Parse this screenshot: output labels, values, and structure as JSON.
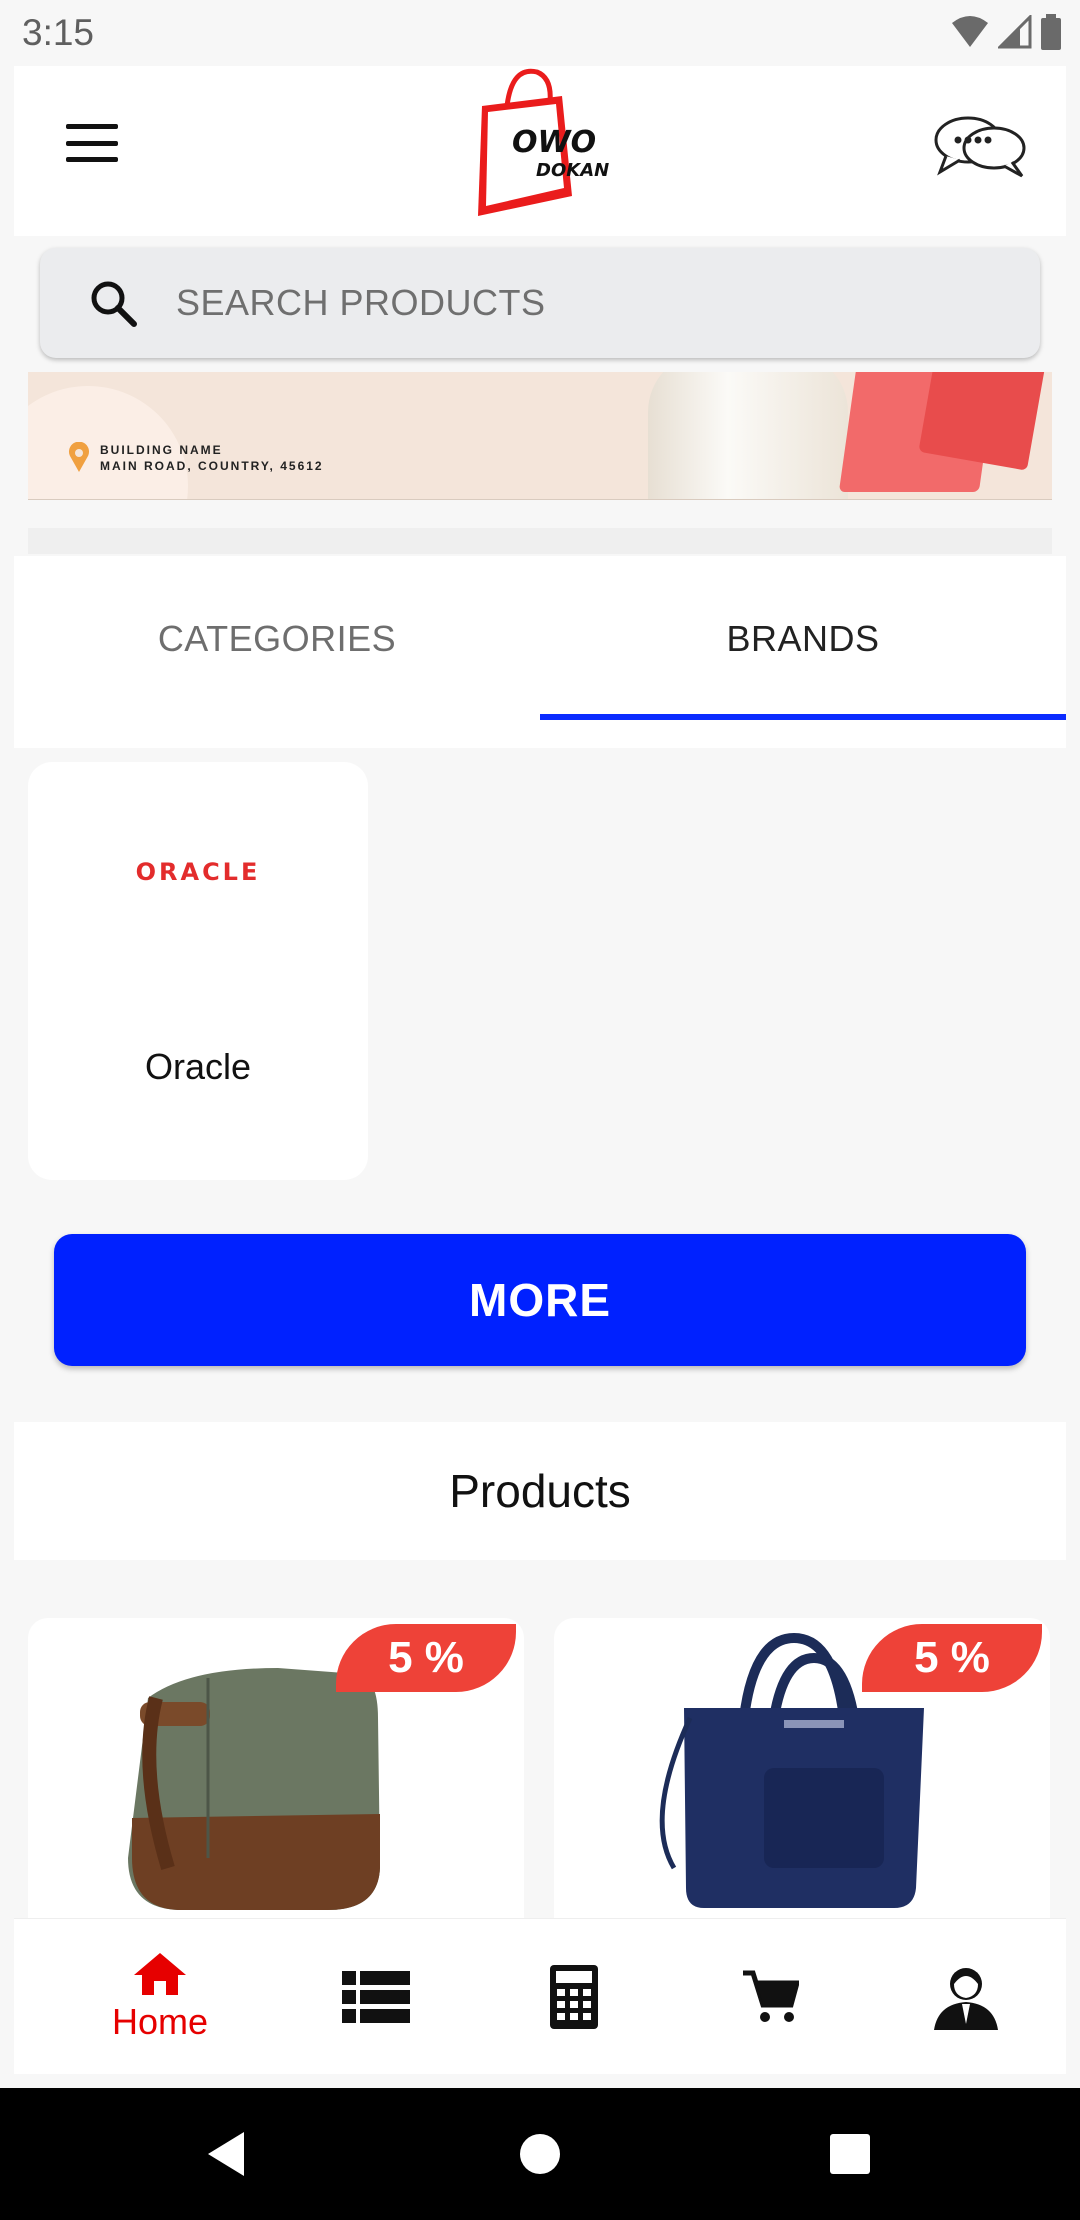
{
  "status_bar": {
    "time": "3:15"
  },
  "header": {
    "logo_text_top": "OWO",
    "logo_text_bottom": "DOKAN"
  },
  "search": {
    "placeholder": "SEARCH PRODUCTS"
  },
  "banner": {
    "address_line1": "BUILDING NAME",
    "address_line2": "MAIN ROAD, COUNTRY, 45612"
  },
  "tabs": [
    {
      "label": "CATEGORIES",
      "selected": false
    },
    {
      "label": "BRANDS",
      "selected": true
    }
  ],
  "brands": [
    {
      "logo_text": "ORACLE",
      "name": "Oracle"
    }
  ],
  "more_button": {
    "label": "MORE"
  },
  "products_section": {
    "title": "Products"
  },
  "products": [
    {
      "discount": "5 %",
      "image": "canvas-toiletry-bag"
    },
    {
      "discount": "5 %",
      "image": "navy-tote-bag"
    }
  ],
  "bottom_nav": [
    {
      "label": "Home",
      "icon": "home-icon",
      "active": true
    },
    {
      "label": "",
      "icon": "list-icon",
      "active": false
    },
    {
      "label": "",
      "icon": "calculator-icon",
      "active": false
    },
    {
      "label": "",
      "icon": "cart-icon",
      "active": false
    },
    {
      "label": "",
      "icon": "profile-icon",
      "active": false
    }
  ],
  "colors": {
    "accent": "#0021ff",
    "brand_red": "#e60000",
    "discount": "#ee4238"
  }
}
